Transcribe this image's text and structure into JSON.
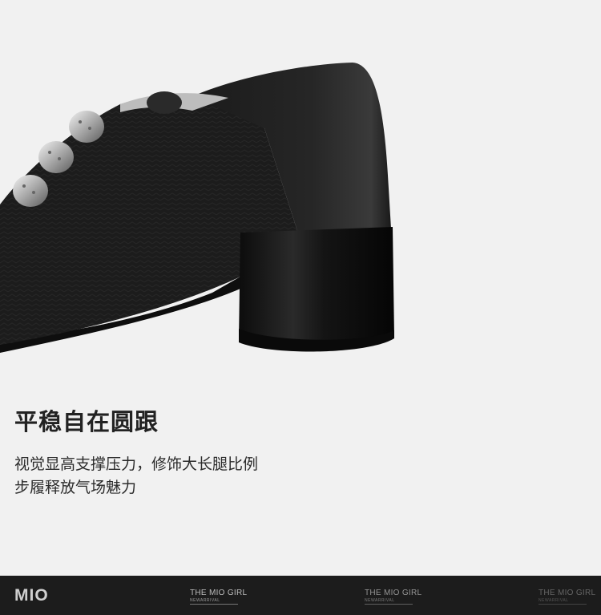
{
  "headline": "平稳自在圆跟",
  "description": {
    "line1": "视觉显高支撑压力，修饰大长腿比例",
    "line2": "步履释放气场魅力"
  },
  "footer": {
    "brand": "MIO",
    "tagline": "THE MIO GIRL",
    "subtagline": "NEWARRIVAL"
  },
  "colors": {
    "background": "#f1f1f1",
    "footer": "#1c1c1c",
    "shoe": "#1a1a1a"
  },
  "image": {
    "subject": "black-leather-block-heel-shoe-with-metal-studs"
  }
}
